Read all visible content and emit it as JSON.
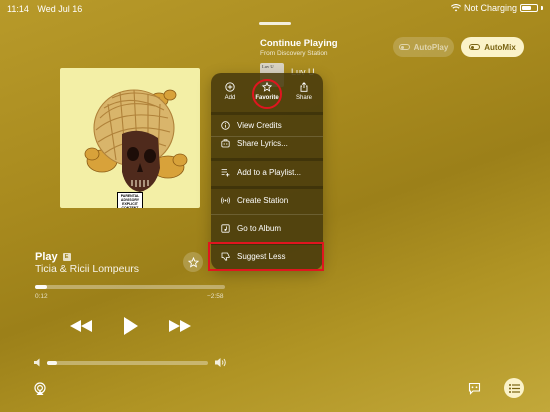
{
  "status_bar": {
    "time": "11:14",
    "date": "Wed Jul 16",
    "charging": "Not Charging",
    "icons": [
      "wifi-icon",
      "battery-icon"
    ]
  },
  "queue": {
    "title": "Continue Playing",
    "subtitle": "From Discovery Station",
    "autoplay_label": "AutoPlay",
    "automix_label": "AutoMix",
    "next_song": "Luv U",
    "next_thumb_text": "Luv U"
  },
  "now_playing": {
    "title": "Play",
    "explicit_badge": "E",
    "artist": "Ticia & Ricii Lompeurs",
    "elapsed": "0:12",
    "remaining": "−2:58",
    "progress": 0.065,
    "volume": 0.06,
    "parental_label": "PARENTAL ADVISORY EXPLICIT CONTENT"
  },
  "context_menu": {
    "top_actions": [
      {
        "label": "Add",
        "icon": "plus-circle-icon"
      },
      {
        "label": "Favorite",
        "icon": "star-icon"
      },
      {
        "label": "Share",
        "icon": "share-icon"
      }
    ],
    "items": [
      {
        "label": "View Credits",
        "icon": "info-icon"
      },
      {
        "label": "Share Lyrics...",
        "icon": "lyrics-icon"
      },
      {
        "label": "Add to a Playlist...",
        "icon": "playlist-add-icon"
      },
      {
        "label": "Create Station",
        "icon": "station-icon"
      },
      {
        "label": "Go to Album",
        "icon": "album-icon"
      },
      {
        "label": "Suggest Less",
        "icon": "thumbs-down-icon"
      }
    ]
  },
  "colors": {
    "background": "#a88a1e",
    "menu_background": "#483a0c",
    "highlight": "#e0151f",
    "automix_pill": "#fbf3c9"
  }
}
